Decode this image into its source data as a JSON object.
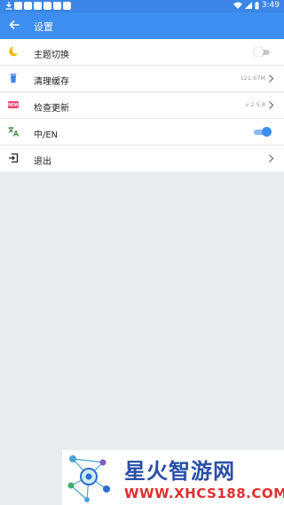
{
  "status_bar": {
    "time": "3:49",
    "download_icon": "download-icon",
    "battery_icon": "battery-icon"
  },
  "toolbar": {
    "title": "设置",
    "back_icon": "arrow-left-icon"
  },
  "settings": [
    {
      "icon": "moon-icon",
      "label": "主题切换",
      "control": "switch",
      "switch_on": false
    },
    {
      "icon": "trash-icon",
      "label": "清理缓存",
      "value": "121.67M",
      "control": "chevron"
    },
    {
      "icon": "new-badge-icon",
      "label": "检查更新",
      "value": "v 2.5.8",
      "control": "chevron"
    },
    {
      "icon": "translate-icon",
      "label": "中/EN",
      "control": "switch",
      "switch_on": true
    },
    {
      "icon": "logout-icon",
      "label": "退出",
      "control": "chevron"
    }
  ],
  "colors": {
    "primary": "#3d8ef0",
    "status_bar": "#3b86e6",
    "background": "#e8ecef",
    "moon": "#f6b900",
    "trash": "#3b86e6",
    "new_badge": "#f0466e"
  },
  "watermark": {
    "title": "星火智游网",
    "url": "WWW.XHCS188.COM"
  }
}
